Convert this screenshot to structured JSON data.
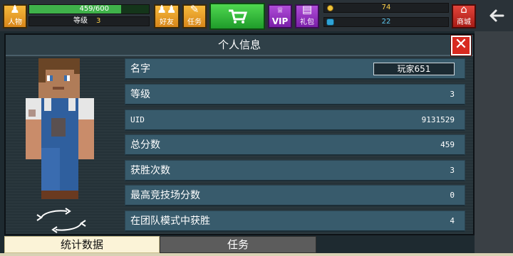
{
  "hud": {
    "character_label": "人物",
    "xp_text": "459/600",
    "xp_fraction": 0.765,
    "level_label": "等级",
    "level_value": "3",
    "friends_label": "好友",
    "tasks_label": "任务",
    "vip_label": "VIP",
    "gift_label": "礼包",
    "coins": "74",
    "gems": "22",
    "mall_label": "商城"
  },
  "panel": {
    "title": "个人信息",
    "rows": [
      {
        "label": "名字",
        "value": "玩家651"
      },
      {
        "label": "等级",
        "value": "3"
      },
      {
        "label": "UID",
        "value": "9131529"
      },
      {
        "label": "总分数",
        "value": "459"
      },
      {
        "label": "获胜次数",
        "value": "3"
      },
      {
        "label": "最高竞技场分数",
        "value": "0"
      },
      {
        "label": "在团队模式中获胜",
        "value": "4"
      }
    ]
  },
  "tabs": [
    {
      "label": "统计数据",
      "active": true
    },
    {
      "label": "任务",
      "active": false
    }
  ],
  "colors": {
    "row_bg": "#385b6c",
    "close_red": "#d82a20",
    "hud_gold": "#f6b93c",
    "hud_green": "#3fb24a"
  },
  "icons": [
    "character-icon",
    "friends-icon",
    "tasks-icon",
    "cart-icon",
    "vip-icon",
    "gift-icon",
    "coin-icon",
    "gem-icon",
    "mall-icon",
    "close-icon",
    "rotate-icon",
    "back-arrow-icon"
  ]
}
